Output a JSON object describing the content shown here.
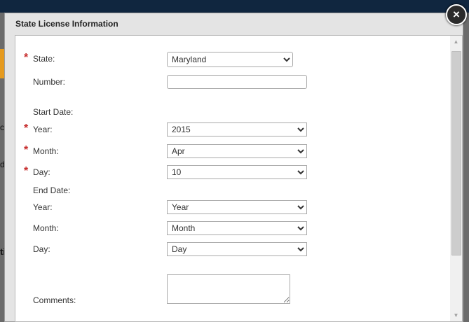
{
  "background": {
    "fragment_1": "cs",
    "fragment_2": "d",
    "fragment_3": "ti"
  },
  "modal": {
    "title": "State License Information",
    "close_icon": "×"
  },
  "form": {
    "state": {
      "label": "State:",
      "required": "*",
      "value": "Maryland"
    },
    "number": {
      "label": "Number:",
      "value": ""
    },
    "start_date_heading": "Start Date:",
    "start_year": {
      "label": "Year:",
      "required": "*",
      "value": "2015"
    },
    "start_month": {
      "label": "Month:",
      "required": "*",
      "value": "Apr"
    },
    "start_day": {
      "label": "Day:",
      "required": "*",
      "value": "10"
    },
    "end_date_heading": "End Date:",
    "end_year": {
      "label": "Year:",
      "value": "Year"
    },
    "end_month": {
      "label": "Month:",
      "value": "Month"
    },
    "end_day": {
      "label": "Day:",
      "value": "Day"
    },
    "comments": {
      "label": "Comments:",
      "value": ""
    }
  }
}
